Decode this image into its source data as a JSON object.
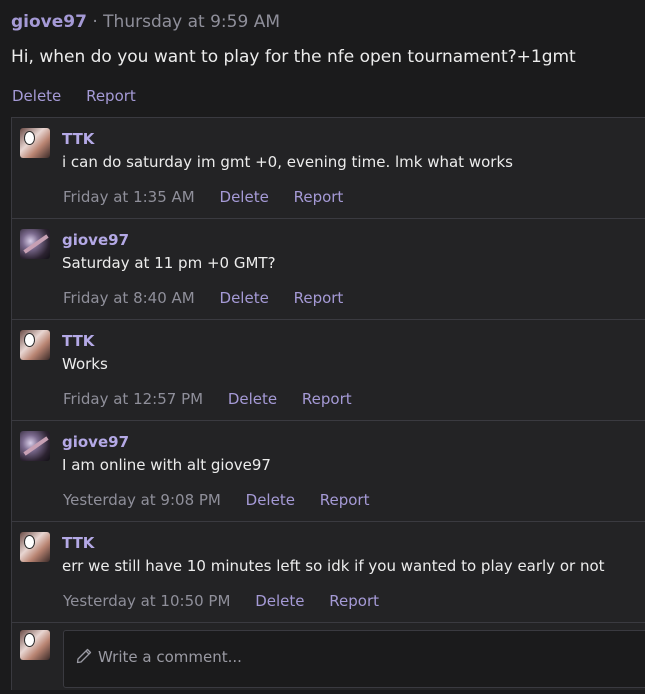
{
  "post": {
    "author": "giove97",
    "separator": "·",
    "time": "Thursday at 9:59 AM",
    "body": "Hi, when do you want to play for the nfe open tournament?+1gmt",
    "delete_label": "Delete",
    "report_label": "Report"
  },
  "comments": [
    {
      "author": "TTK",
      "avatar": "ttk-avatar",
      "text": "i can do saturday im gmt +0, evening time. lmk what works",
      "time": "Friday at 1:35 AM",
      "delete_label": "Delete",
      "report_label": "Report"
    },
    {
      "author": "giove97",
      "avatar": "giove97-avatar",
      "text": "Saturday at 11 pm +0 GMT?",
      "time": "Friday at 8:40 AM",
      "delete_label": "Delete",
      "report_label": "Report"
    },
    {
      "author": "TTK",
      "avatar": "ttk-avatar",
      "text": "Works",
      "time": "Friday at 12:57 PM",
      "delete_label": "Delete",
      "report_label": "Report"
    },
    {
      "author": "giove97",
      "avatar": "giove97-avatar",
      "text": "I am online with alt giove97",
      "time": "Yesterday at 9:08 PM",
      "delete_label": "Delete",
      "report_label": "Report"
    },
    {
      "author": "TTK",
      "avatar": "ttk-avatar",
      "text": "err we still have 10 minutes left so idk if you wanted to play early or not",
      "time": "Yesterday at 10:50 PM",
      "delete_label": "Delete",
      "report_label": "Report"
    }
  ],
  "composer": {
    "placeholder": "Write a comment...",
    "icon": "pencil-icon"
  },
  "colors": {
    "background": "#1b1b1c",
    "panel": "#232325",
    "accent": "#9d8fe0",
    "link": "#a59ad6",
    "muted": "#8f8f9a"
  }
}
